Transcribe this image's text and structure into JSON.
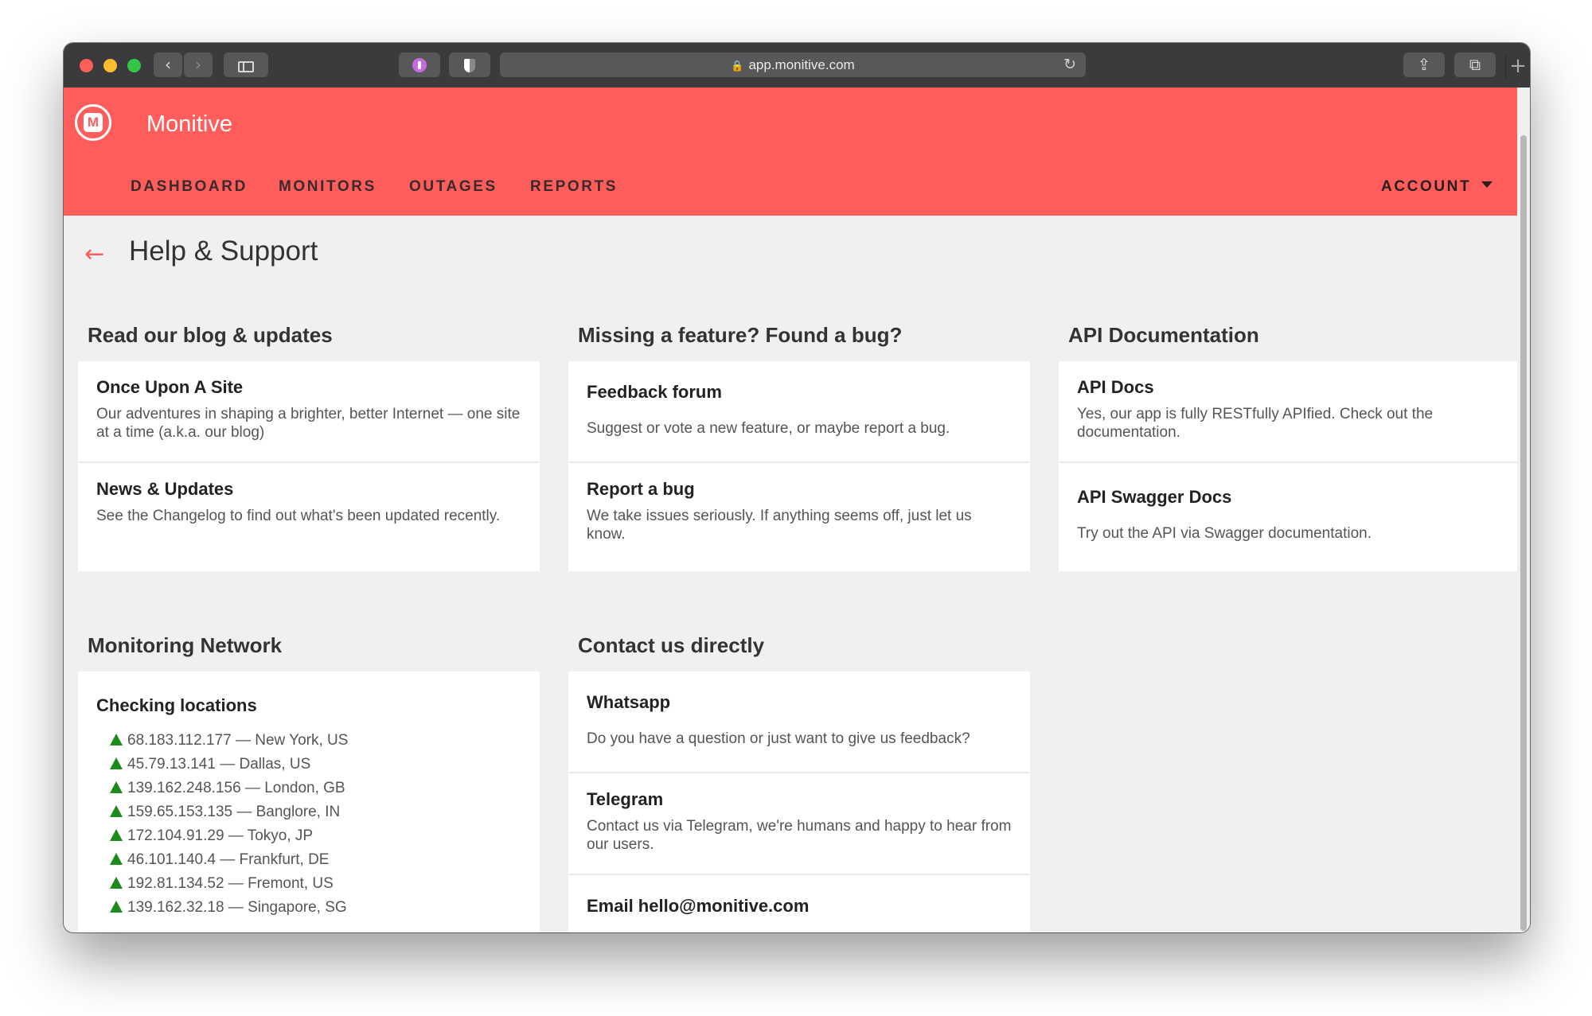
{
  "browser": {
    "url": "app.monitive.com"
  },
  "app": {
    "brand": "Monitive",
    "logo_letter": "M",
    "nav": [
      "DASHBOARD",
      "MONITORS",
      "OUTAGES",
      "REPORTS"
    ],
    "account": "ACCOUNT"
  },
  "page": {
    "title": "Help & Support"
  },
  "sections": {
    "blog": {
      "title": "Read our blog & updates",
      "cards": [
        {
          "title": "Once Upon A Site",
          "desc": "Our adventures in shaping a brighter, better Internet — one site at a time (a.k.a. our blog)"
        },
        {
          "title": "News & Updates",
          "desc": "See the Changelog to find out what's been updated recently."
        }
      ]
    },
    "feature": {
      "title": "Missing a feature? Found a bug?",
      "cards": [
        {
          "title": "Feedback forum",
          "desc": "Suggest or vote a new feature, or maybe report a bug."
        },
        {
          "title": "Report a bug",
          "desc": "We take issues seriously. If anything seems off, just let us know."
        }
      ]
    },
    "api": {
      "title": "API Documentation",
      "cards": [
        {
          "title": "API Docs",
          "desc": "Yes, our app is fully RESTfully APIfied. Check out the documentation."
        },
        {
          "title": "API Swagger Docs",
          "desc": "Try out the API via Swagger documentation."
        }
      ]
    },
    "network": {
      "title": "Monitoring Network",
      "card_title": "Checking locations",
      "locations": [
        "68.183.112.177 — New York, US",
        "45.79.13.141 — Dallas, US",
        "139.162.248.156 — London, GB",
        "159.65.153.135 — Banglore, IN",
        "172.104.91.29 — Tokyo, JP",
        "46.101.140.4 — Frankfurt, DE",
        "192.81.134.52 — Fremont, US",
        "139.162.32.18 — Singapore, SG"
      ]
    },
    "contact": {
      "title": "Contact us directly",
      "cards": [
        {
          "title": "Whatsapp",
          "desc": "Do you have a question or just want to give us feedback?"
        },
        {
          "title": "Telegram",
          "desc": "Contact us via Telegram, we're humans and happy to hear from our users."
        },
        {
          "title": "Email hello@monitive.com",
          "desc": ""
        }
      ]
    }
  },
  "colors": {
    "brand": "#ff5c5c",
    "status_up": "#1d8a1d"
  }
}
